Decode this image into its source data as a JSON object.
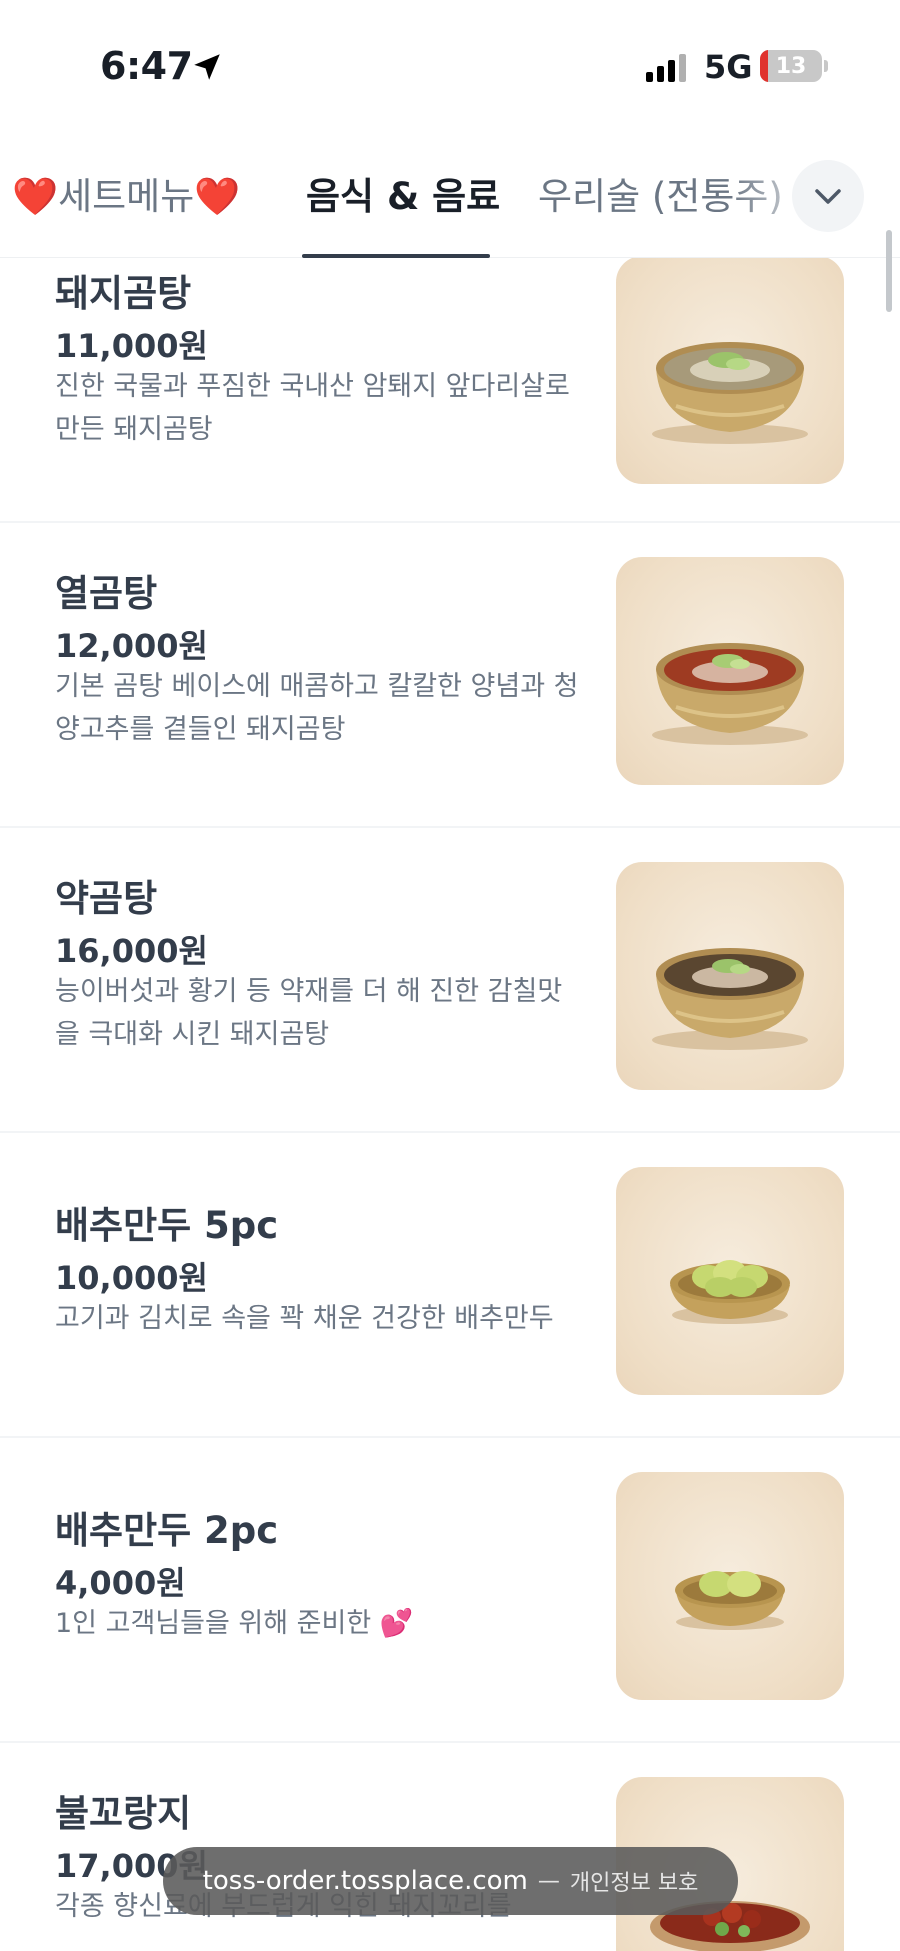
{
  "status_bar": {
    "time": "6:47",
    "network": "5G",
    "battery": "13",
    "battery_level_percent": 13
  },
  "tabs": [
    {
      "label": "❤️세트메뉴❤️",
      "active": false
    },
    {
      "label": "음식 & 음료",
      "active": true
    },
    {
      "label": "우리술 (전통주)",
      "active": false
    }
  ],
  "more_icon": "chevron-down-icon",
  "menu_items": [
    {
      "name": "돼지곰탕",
      "price": "11,000원",
      "desc": "진한 국물과 푸짐한 국내산 암퇘지 앞다리살로 만든 돼지곰탕",
      "photo": "clear-gomtang-bowl"
    },
    {
      "name": "열곰탕",
      "price": "12,000원",
      "desc": "기본 곰탕 베이스에 매콤하고 칼칼한 양념과 청양고추를 곁들인 돼지곰탕",
      "photo": "spicy-gomtang-bowl"
    },
    {
      "name": "약곰탕",
      "price": "16,000원",
      "desc": "능이버섯과 황기 등 약재를 더 해 진한 감칠맛을 극대화 시킨 돼지곰탕",
      "photo": "herbal-gomtang-bowl"
    },
    {
      "name": "배추만두 5pc",
      "price": "10,000원",
      "desc": "고기과 김치로 속을 꽉 채운 건강한 배추만두",
      "photo": "cabbage-dumplings-5"
    },
    {
      "name": "배추만두 2pc",
      "price": "4,000원",
      "desc": "1인 고객님들을 위해 준비한 💕",
      "photo": "cabbage-dumplings-2"
    },
    {
      "name": "불꼬랑지",
      "price": "17,000원",
      "desc": "각종 향신료에 부드럽게 익힌 돼지꼬리를",
      "photo": "spicy-pork-tail"
    }
  ],
  "url_bar": {
    "domain": "toss-order.tossplace.com",
    "separator": "—",
    "privacy": "개인정보 보호"
  },
  "colors": {
    "text": "#191f28",
    "muted": "#6b7684",
    "brass": "#c9a96a"
  }
}
